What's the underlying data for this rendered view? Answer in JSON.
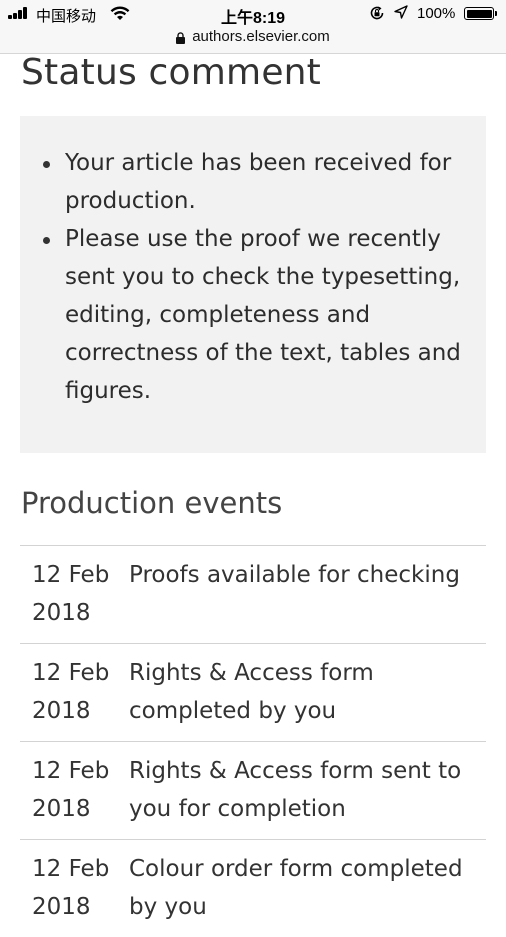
{
  "status_bar": {
    "carrier": "中国移动",
    "time": "上午8:19",
    "battery_percent": "100%",
    "battery_level": 1.0,
    "icons": [
      "signal-icon",
      "wifi-icon",
      "rotation-lock-icon",
      "location-icon",
      "battery-icon"
    ]
  },
  "url_bar": {
    "domain": "authors.elsevier.com",
    "icon": "padlock-icon"
  },
  "status_comment": {
    "heading": "Status comment",
    "items": [
      "Your article has been received for production.",
      "Please use the proof we recently sent you to check the typesetting, editing, completeness and correctness of the text, tables and figures."
    ]
  },
  "production_events": {
    "heading": "Production events",
    "events": [
      {
        "date": "12 Feb 2018",
        "description": "Proofs available for checking"
      },
      {
        "date": "12 Feb 2018",
        "description": "Rights & Access form completed by you"
      },
      {
        "date": "12 Feb 2018",
        "description": "Rights & Access form sent to you for completion"
      },
      {
        "date": "12 Feb 2018",
        "description": "Colour order form completed by you"
      }
    ]
  },
  "colors": {
    "status_bar_bg": "#f7f7f7",
    "comment_box_bg": "#f2f2f2",
    "divider": "#d3d3d3",
    "text": "#333333"
  }
}
